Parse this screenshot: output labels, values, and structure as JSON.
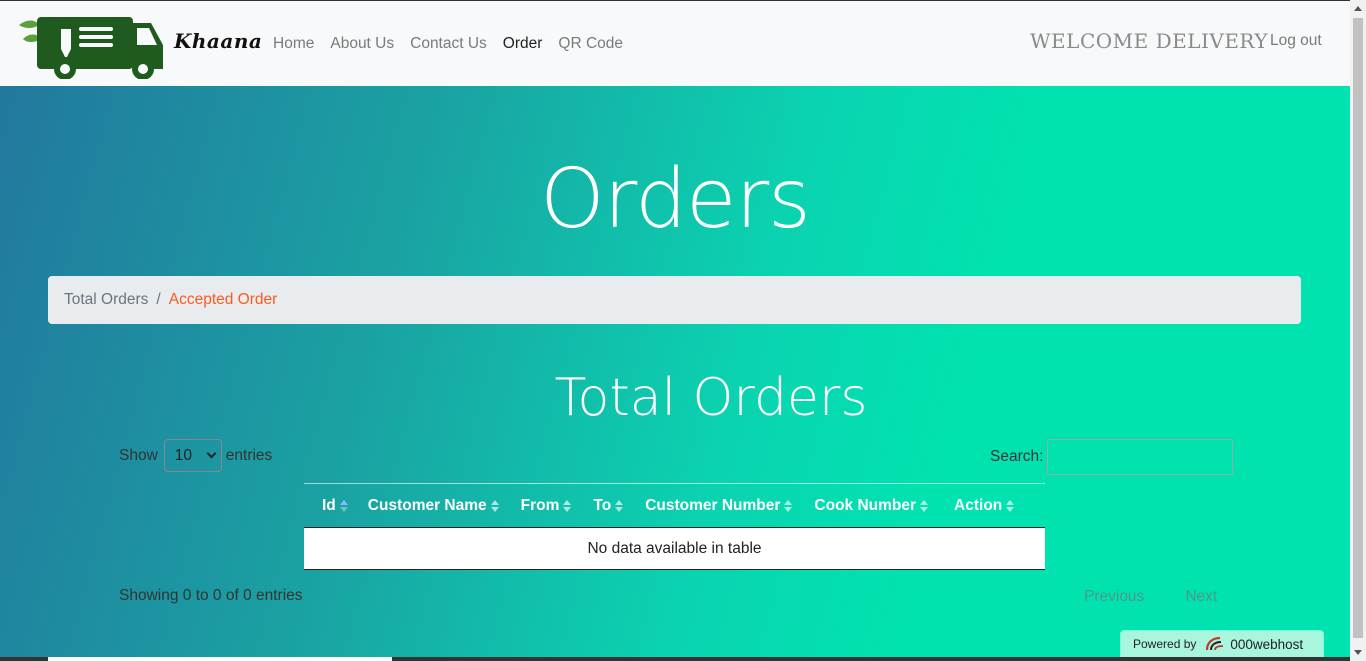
{
  "brand": {
    "name": "Khaana",
    "logo": "food-truck-icon"
  },
  "nav": {
    "links": [
      {
        "label": "Home",
        "active": false
      },
      {
        "label": "About Us",
        "active": false
      },
      {
        "label": "Contact Us",
        "active": false
      },
      {
        "label": "Order",
        "active": true
      },
      {
        "label": "QR Code",
        "active": false
      }
    ],
    "welcome": "WELCOME DELIVERY",
    "logout": "Log out"
  },
  "hero": {
    "title": "Orders"
  },
  "breadcrumb": {
    "items": [
      "Total Orders",
      "Accepted Order"
    ],
    "separator": "/"
  },
  "section": {
    "title": "Total Orders"
  },
  "table_controls": {
    "show_label": "Show",
    "entries_value": "10",
    "entries_label": "entries",
    "search_label": "Search:",
    "search_value": ""
  },
  "table": {
    "columns": [
      "Id",
      "Customer Name",
      "From",
      "To",
      "Customer Number",
      "Cook Number",
      "Action"
    ],
    "empty_message": "No data available in table"
  },
  "footer": {
    "info": "Showing 0 to 0 of 0 entries",
    "previous": "Previous",
    "next": "Next"
  },
  "powered": {
    "label": "Powered by",
    "host": "000webhost"
  },
  "colors": {
    "accent": "#fd5a1e",
    "hero_left": "#22789e",
    "hero_right": "#00e3b0",
    "logo_green": "#1f5a1f"
  }
}
